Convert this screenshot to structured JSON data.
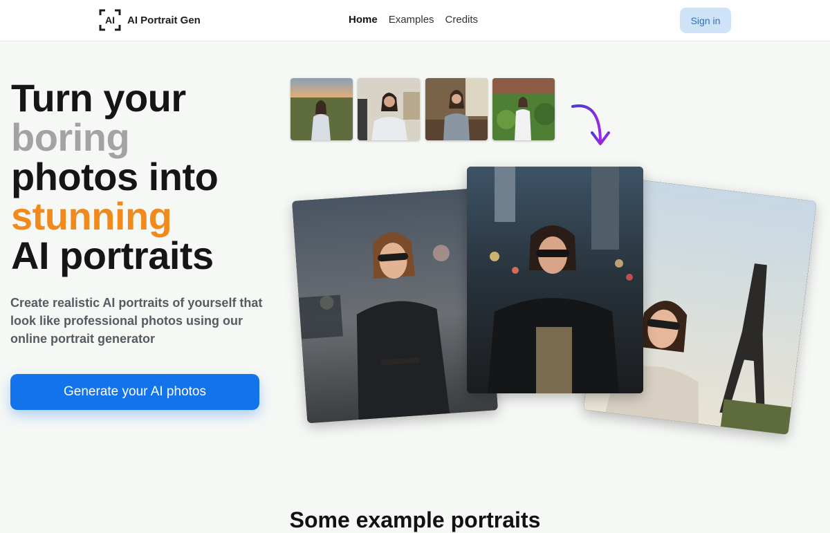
{
  "header": {
    "logo_mark": "AI",
    "brand": "AI Portrait Gen",
    "nav": [
      {
        "label": "Home",
        "active": true
      },
      {
        "label": "Examples",
        "active": false
      },
      {
        "label": "Credits",
        "active": false
      }
    ],
    "signin_label": "Sign in"
  },
  "hero": {
    "headline": [
      "Turn your",
      "boring",
      "photos into",
      "stunning",
      "AI portraits"
    ],
    "subtitle": "Create realistic AI portraits of yourself that look like professional photos using our online portrait generator",
    "cta_label": "Generate your AI photos"
  },
  "thumbnails": [
    {
      "icon": "portrait-field-sunset-thumbnail"
    },
    {
      "icon": "portrait-indoor-white-shirt-thumbnail"
    },
    {
      "icon": "portrait-living-room-thumbnail"
    },
    {
      "icon": "portrait-garden-thumbnail"
    }
  ],
  "arrow_icon": "curved-arrow-down-icon",
  "portraits": [
    {
      "icon": "ai-portrait-city-street"
    },
    {
      "icon": "ai-portrait-night-city"
    },
    {
      "icon": "ai-portrait-eiffel-tower"
    }
  ],
  "colors": {
    "accent_blue": "#1273ea",
    "highlight_orange": "#f08a1c",
    "muted_grey": "#a3a3a3",
    "arrow_purple": "#9b2be0"
  },
  "next_section_title": "Some example portraits"
}
